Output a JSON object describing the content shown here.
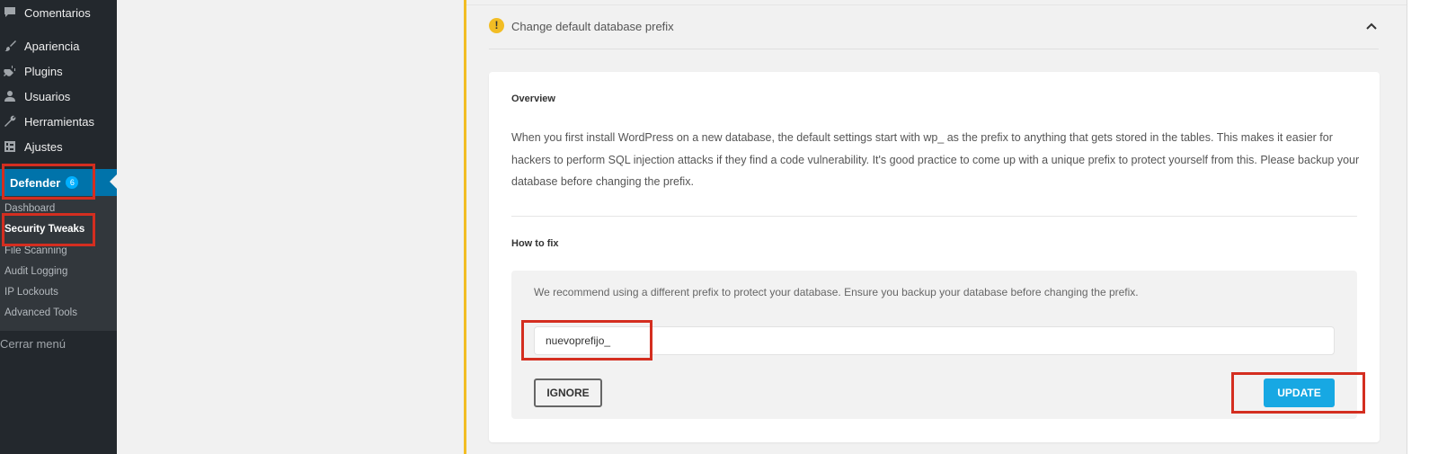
{
  "sidebar": {
    "items": [
      {
        "label": "Comentarios",
        "icon": "comment-icon"
      },
      {
        "label": "Apariencia",
        "icon": "paint-brush-icon"
      },
      {
        "label": "Plugins",
        "icon": "plug-icon"
      },
      {
        "label": "Usuarios",
        "icon": "user-icon"
      },
      {
        "label": "Herramientas",
        "icon": "wrench-icon"
      },
      {
        "label": "Ajustes",
        "icon": "settings-icon"
      }
    ],
    "defender": {
      "label": "Defender",
      "badge": "6",
      "icon": "defender-shield-icon"
    },
    "submenu": [
      {
        "label": "Dashboard"
      },
      {
        "label": "Security Tweaks"
      },
      {
        "label": "File Scanning"
      },
      {
        "label": "Audit Logging"
      },
      {
        "label": "IP Lockouts"
      },
      {
        "label": "Advanced Tools"
      }
    ],
    "collapse": {
      "label": "Cerrar menú",
      "icon": "collapse-icon"
    }
  },
  "tweak": {
    "title": "Change default database prefix",
    "overview_heading": "Overview",
    "overview_text": "When you first install WordPress on a new database, the default settings start with wp_ as the prefix to anything that gets stored in the tables. This makes it easier for hackers to perform SQL injection attacks if they find a code vulnerability. It's good practice to come up with a unique prefix to protect yourself from this. Please backup your database before changing the prefix.",
    "howto_heading": "How to fix",
    "howto_text": "We recommend using a different prefix to protect your database. Ensure you backup your database before changing the prefix.",
    "prefix_value": "nuevoprefijo_",
    "ignore_label": "IGNORE",
    "update_label": "UPDATE"
  },
  "colors": {
    "sidebar_bg": "#23282d",
    "active_blue": "#0073aa",
    "warning_yellow": "#f2bd24",
    "update_blue": "#17a8e3",
    "highlight_red": "#d42e20"
  }
}
